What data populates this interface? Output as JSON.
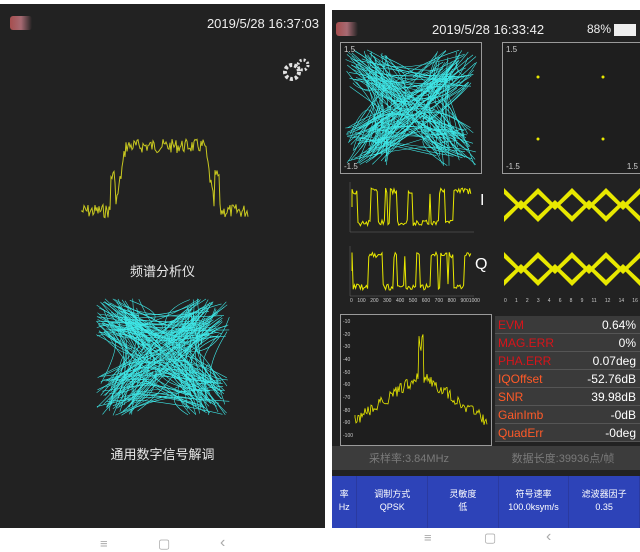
{
  "left_phone": {
    "datetime": "2019/5/28 16:37:03",
    "spectrum_label": "频谱分析仪",
    "demod_label": "通用数字信号解调",
    "nav": {
      "menu": "≡",
      "home": "▢",
      "back": "‹"
    }
  },
  "right_phone": {
    "datetime": "2019/5/28 16:33:42",
    "battery": "88%",
    "const_scale": {
      "max": "1.5",
      "min": "-1.5",
      "max2": "1.5",
      "min2": "-1.5",
      "right": "1.5"
    },
    "i_label": "I",
    "q_label": "Q",
    "x_ticks": [
      "0",
      "100",
      "200",
      "300",
      "400",
      "500",
      "600",
      "700",
      "800",
      "9001000"
    ],
    "eye_ticks": [
      "0",
      "1",
      "2",
      "3",
      "4",
      "6",
      "8",
      "9",
      "11",
      "12",
      "14",
      "16"
    ],
    "spec_ticks": [
      "-10",
      "-20",
      "-30",
      "-40",
      "-50",
      "-60",
      "-70",
      "-80",
      "-90",
      "-100"
    ],
    "metrics": [
      {
        "key": "EVM",
        "value": "0.64%",
        "red": true
      },
      {
        "key": "MAG.ERR",
        "value": "0%",
        "red": true
      },
      {
        "key": "PHA.ERR",
        "value": "0.07deg",
        "red": true
      },
      {
        "key": "IQOffset",
        "value": "-52.76dB",
        "red": false
      },
      {
        "key": "SNR",
        "value": "39.98dB",
        "red": false
      },
      {
        "key": "GainImb",
        "value": "-0dB",
        "red": false
      },
      {
        "key": "QuadErr",
        "value": "-0deg",
        "red": false
      }
    ],
    "sample_rate": "采样率:3.84MHz",
    "data_length": "数据长度:39936点/帧",
    "buttons": [
      {
        "line1": "率",
        "line2": "Hz"
      },
      {
        "line1": "调制方式",
        "line2": "QPSK"
      },
      {
        "line1": "灵敏度",
        "line2": "低"
      },
      {
        "line1": "符号速率",
        "line2": "100.0ksym/s"
      },
      {
        "line1": "滤波器因子",
        "line2": "0.35"
      }
    ],
    "nav": {
      "menu": "≡",
      "home": "▢",
      "back": "‹"
    }
  },
  "colors": {
    "constellation": "#3ee6e6",
    "signal": "#e8e800",
    "background": "#222222",
    "bottom_bar": "#2d43b8"
  }
}
